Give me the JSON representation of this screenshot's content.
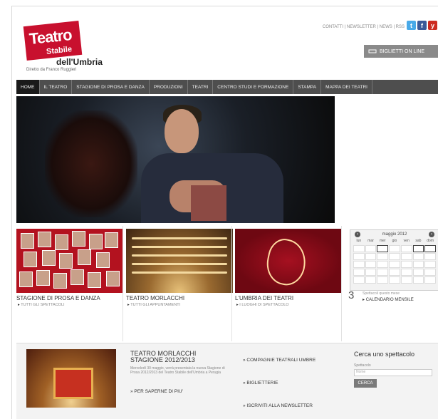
{
  "logo": {
    "line1": "Teatro",
    "line2": "Stabile",
    "line3": "dell'Umbria",
    "tagline": "Diretto da Franco Ruggieri"
  },
  "header": {
    "links": "CONTATTI | NEWSLETTER | NEWS | RSS",
    "tickets_label": "BIGLIETTI ON LINE"
  },
  "social": [
    {
      "name": "twitter-icon",
      "glyph": "t",
      "color": "#48a9e8"
    },
    {
      "name": "facebook-icon",
      "glyph": "f",
      "color": "#3b5998"
    },
    {
      "name": "youtube-icon",
      "glyph": "y",
      "color": "#cc2a20"
    }
  ],
  "nav": [
    "HOME",
    "IL TEATRO",
    "STAGIONE DI PROSA E DANZA",
    "PRODUZIONI",
    "TEATRI",
    "CENTRO STUDI E FORMAZIONE",
    "STAMPA",
    "MAPPA DEI TEATRI"
  ],
  "features": [
    {
      "title": "STAGIONE DI PROSA E DANZA",
      "sub": "TUTTI GLI SPETTACOLI"
    },
    {
      "title": "TEATRO MORLACCHI",
      "sub": "TUTTI GLI APPUNTAMENTI"
    },
    {
      "title": "L'UMBRIA DEI TEATRI",
      "sub": "I LUOGHI DI SPETTACOLO"
    }
  ],
  "calendar": {
    "month": "maggio 2012",
    "days": [
      "lun",
      "mar",
      "mer",
      "gio",
      "ven",
      "sab",
      "dom"
    ],
    "day_number": "3",
    "day_text": "Spettacoli questo mese",
    "button": "CALENDARIO MENSILE"
  },
  "bottom": {
    "title": "TEATRO MORLACCHI STAGIONE 2012/2013",
    "desc": "Mercoledì 30 maggio, verrà presentata la nuova Stagione di Prosa 2012/2013 del Teatro Stabile dell'Umbria a Perugia",
    "more": "PER SAPERNE DI PIU'",
    "links": [
      "COMPAGNIE TEATRALI UMBRE",
      "BIGLIETTERIE",
      "ISCRIVITI ALLA NEWSLETTER"
    ],
    "search_title": "Cerca uno spettacolo",
    "search_label": "Spettacolo",
    "search_placeholder": "Nome",
    "search_button": "CERCA"
  },
  "colors": {
    "brand_red": "#c8102e",
    "nav_bg": "#4e4e4e"
  }
}
